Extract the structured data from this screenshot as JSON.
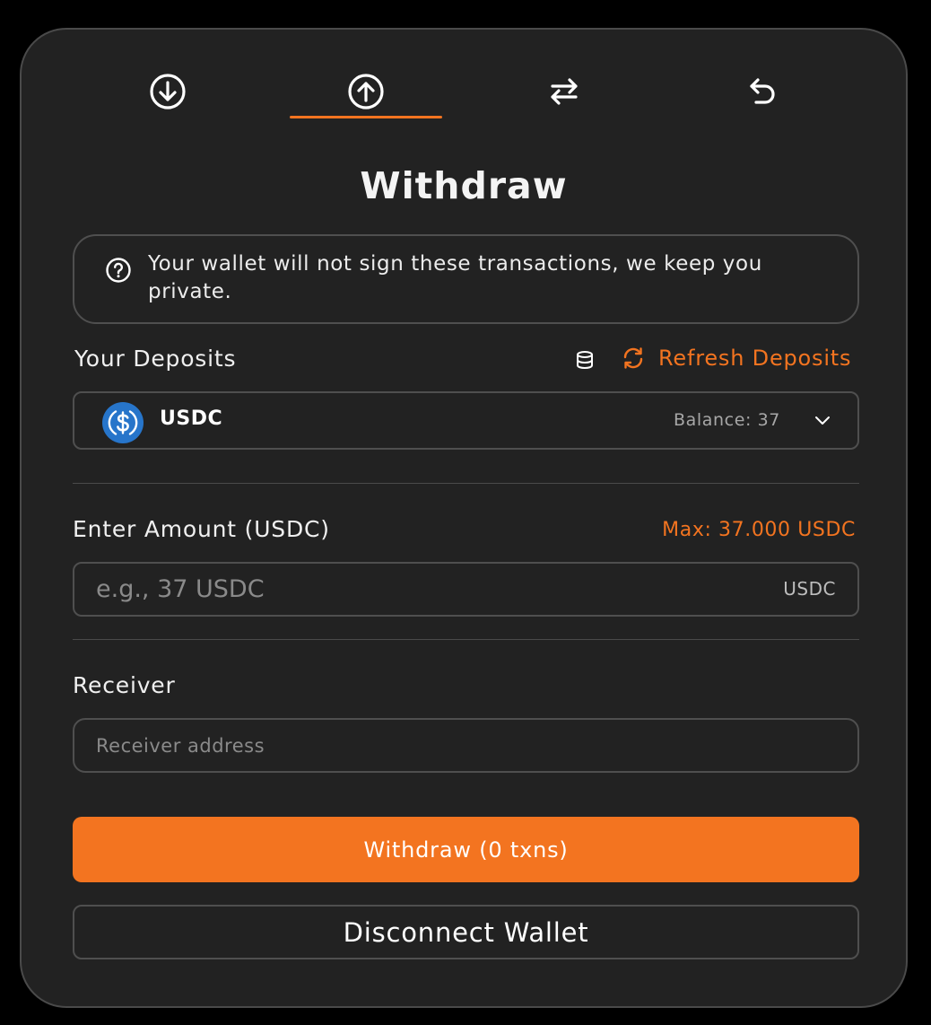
{
  "tabs": [
    {
      "icon": "arrow-down-circle-icon",
      "active": false
    },
    {
      "icon": "arrow-up-circle-icon",
      "active": true
    },
    {
      "icon": "swap-arrows-icon",
      "active": false
    },
    {
      "icon": "undo-arrow-icon",
      "active": false
    }
  ],
  "title": "Withdraw",
  "notice": {
    "icon": "question-circle-icon",
    "text": "Your wallet will not sign these transactions, we keep you private."
  },
  "deposits": {
    "label": "Your Deposits",
    "db_icon": "database-icon",
    "refresh_icon": "refresh-icon",
    "refresh_label": "Refresh Deposits",
    "selected": {
      "token": "USDC",
      "logo_icon": "usdc-coin-icon",
      "balance": "Balance: 37"
    }
  },
  "amount": {
    "label": "Enter Amount (USDC)",
    "max": "Max: 37.000 USDC",
    "placeholder": "e.g., 37 USDC",
    "unit": "USDC"
  },
  "receiver": {
    "label": "Receiver",
    "placeholder": "Receiver address"
  },
  "buttons": {
    "withdraw": "Withdraw (0 txns)",
    "disconnect": "Disconnect Wallet"
  },
  "colors": {
    "accent": "#f37420",
    "background": "#222222",
    "border": "#4f4f4f",
    "usdc_blue": "#2775ca"
  }
}
